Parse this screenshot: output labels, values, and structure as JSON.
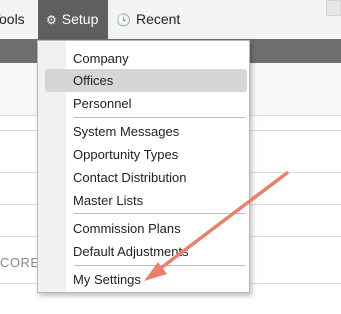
{
  "menubar": {
    "tools_label": "Tools",
    "setup_label": "Setup",
    "recent_label": "Recent"
  },
  "background": {
    "partial_text": "CORE I"
  },
  "setup_menu": {
    "items": [
      "Company",
      "Offices",
      "Personnel",
      "System Messages",
      "Opportunity Types",
      "Contact Distribution",
      "Master Lists",
      "Commission Plans",
      "Default Adjustments",
      "My Settings"
    ],
    "highlighted": "Offices"
  },
  "annotation": {
    "arrow_color": "#e8826a"
  },
  "colors": {
    "active_menu_bg": "#5f5f5f",
    "highlight_bg": "#d6d6d6",
    "menubar_bg": "#f3f3f3"
  }
}
